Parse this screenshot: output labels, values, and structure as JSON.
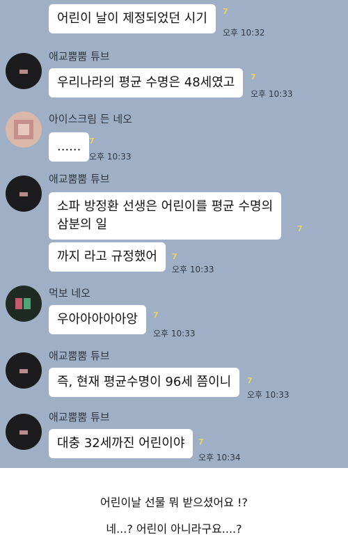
{
  "messages": [
    {
      "id": "m1",
      "text": "어린이 날이 제정되었던 시기",
      "unread": "7",
      "time": "오후 10:32"
    },
    {
      "id": "m2",
      "sender": "애교뿜뿜 튜브",
      "text": "우리나라의 평균 수명은 48세였고",
      "unread": "7",
      "time": "오후 10:33"
    },
    {
      "id": "m3",
      "sender": "아이스크림 든 네오",
      "text": "......",
      "unread": "7",
      "time": "오후 10:33"
    },
    {
      "id": "m4",
      "sender": "애교뿜뿜 튜브",
      "text": "소파 방정환 선생은 어린이를 평균 수명의\n삼분의 일",
      "unread": "7"
    },
    {
      "id": "m5",
      "text": "까지 라고 규정했어",
      "unread": "7",
      "time": "오후 10:33"
    },
    {
      "id": "m6",
      "sender": "먹보 네오",
      "text": "우아아아아아앙",
      "unread": "7",
      "time": "오후 10:33"
    },
    {
      "id": "m7",
      "sender": "애교뿜뿜 튜브",
      "text": "즉, 현재 평균수명이 96세 쯤이니",
      "unread": "7",
      "time": "오후 10:33"
    },
    {
      "id": "m8",
      "sender": "애교뿜뿜 튜브",
      "text": "대충 32세까진 어린이야",
      "unread": "7",
      "time": "오후 10:34"
    }
  ],
  "caption": {
    "line1": "어린이날 선물 뭐 받으셨어요 !?",
    "line2": "네...? 어린이 아니라구요....?"
  }
}
